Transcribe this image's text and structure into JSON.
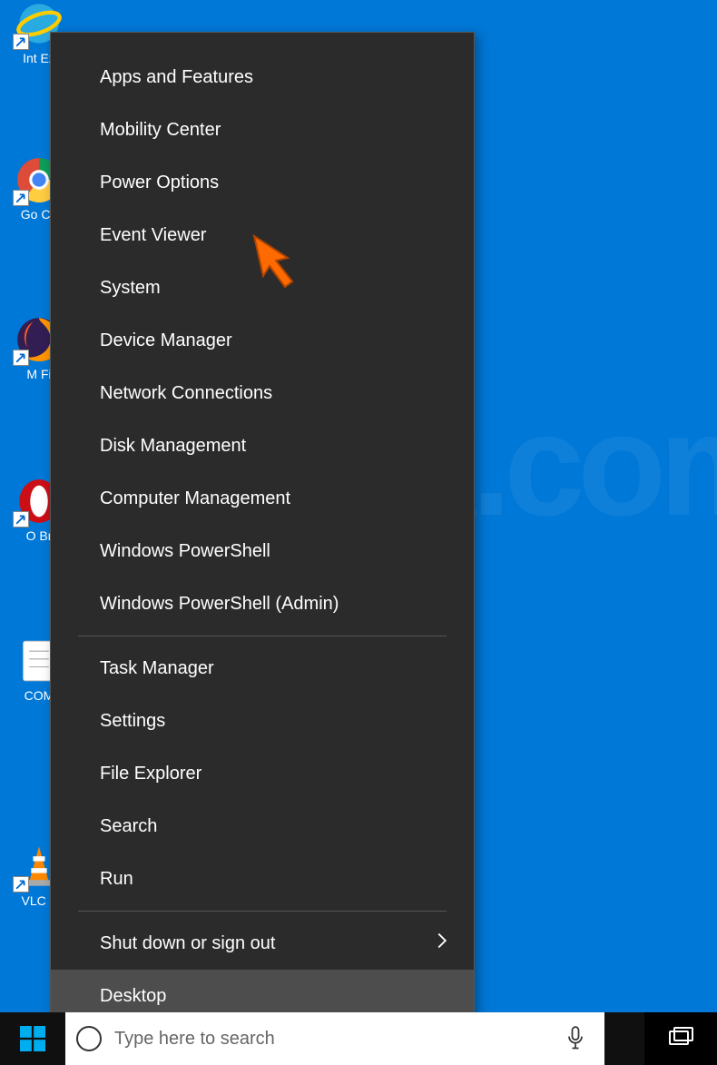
{
  "desktop_icons": [
    {
      "label": "Internet Explorer",
      "short": "Int\nEx"
    },
    {
      "label": "Google Chrome",
      "short": "Go\nCh"
    },
    {
      "label": "Mozilla Firefox",
      "short": "M\nFi"
    },
    {
      "label": "Opera Browser",
      "short": "O\nBr"
    },
    {
      "label": "COM",
      "short": "COM"
    },
    {
      "label": "VLC player",
      "short": "VLC\np"
    }
  ],
  "context_menu": {
    "groups": [
      [
        "Apps and Features",
        "Mobility Center",
        "Power Options",
        "Event Viewer",
        "System",
        "Device Manager",
        "Network Connections",
        "Disk Management",
        "Computer Management",
        "Windows PowerShell",
        "Windows PowerShell (Admin)"
      ],
      [
        "Task Manager",
        "Settings",
        "File Explorer",
        "Search",
        "Run"
      ],
      [
        {
          "label": "Shut down or sign out",
          "submenu": true
        },
        {
          "label": "Desktop",
          "hovered": true
        }
      ]
    ]
  },
  "taskbar": {
    "search_placeholder": "Type here to search"
  },
  "annotation": {
    "target_item": "Event Viewer"
  },
  "watermark_text": "PCrisk.com"
}
